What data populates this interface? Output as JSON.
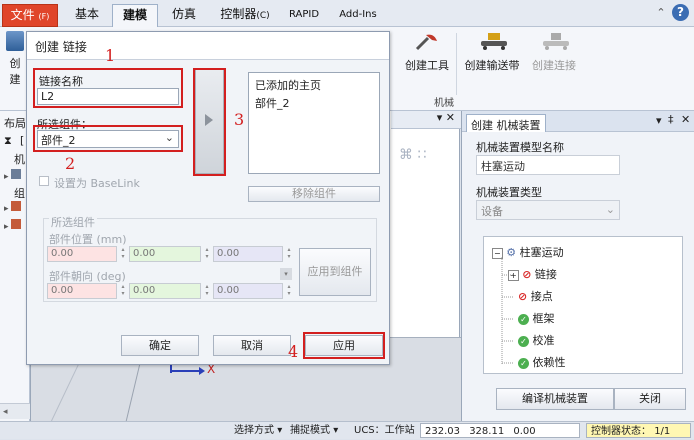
{
  "ribbon": {
    "tabs": [
      {
        "label": "文件",
        "suffix": "(F)"
      },
      {
        "label": "基本"
      },
      {
        "label": "建模"
      },
      {
        "label": "仿真"
      },
      {
        "label": "控制器",
        "suffix": "(C)"
      },
      {
        "label": "RAPID"
      },
      {
        "label": "Add-Ins"
      }
    ],
    "buttons": {
      "create_partial": "创",
      "create_partial2": "建",
      "create_tool": "创建工具",
      "create_conveyor": "创建输送带",
      "create_connection": "创建连接"
    },
    "group_label": "机械"
  },
  "left_panel": {
    "title": "布局",
    "items": [
      "[",
      "机",
      "组"
    ]
  },
  "dialog": {
    "title": "创建 链接",
    "link_name_label": "链接名称",
    "link_name_value": "L2",
    "selected_part_label": "所选组件：",
    "selected_part_value": "部件_2",
    "set_baselink_label": "设置为 BaseLink",
    "added_pages_header": "已添加的主页",
    "added_pages": [
      "部件_2"
    ],
    "remove_button": "移除组件",
    "group_title": "所选组件",
    "part_position_label": "部件位置 (mm)",
    "part_orientation_label": "部件朝向 (deg)",
    "position_values": [
      "0.00",
      "0.00",
      "0.00"
    ],
    "orientation_values": [
      "0.00",
      "0.00",
      "0.00"
    ],
    "apply_to_part_button": "应用到组件",
    "ok_button": "确定",
    "cancel_button": "取消",
    "apply_button": "应用",
    "annotations": [
      "1",
      "2",
      "3",
      "4"
    ]
  },
  "right_panel": {
    "tab_label": "创建 机械装置",
    "model_name_label": "机械装置模型名称",
    "model_name_value": "柱塞运动",
    "type_label": "机械装置类型",
    "type_value": "设备",
    "tree": {
      "root": "柱塞运动",
      "children": [
        "链接",
        "接点",
        "框架",
        "校准",
        "依赖性"
      ]
    },
    "compile_button": "编译机械装置",
    "close_button": "关闭"
  },
  "status_bar": {
    "select_mode": "选择方式",
    "snap_mode": "捕捉模式",
    "ucs": "UCS：工作站",
    "coord_x": "232.03",
    "coord_y": "328.11",
    "coord_z": "0.00",
    "controller_status_label": "控制器状态：",
    "controller_status_value": "1/1"
  },
  "viewport": {
    "axis_x_label": "X"
  },
  "colors": {
    "file_tab": "#e0452a",
    "annotation_red": "#d31f1f",
    "ok_green": "#4caf50",
    "forbidden_red": "#d92b2b"
  }
}
